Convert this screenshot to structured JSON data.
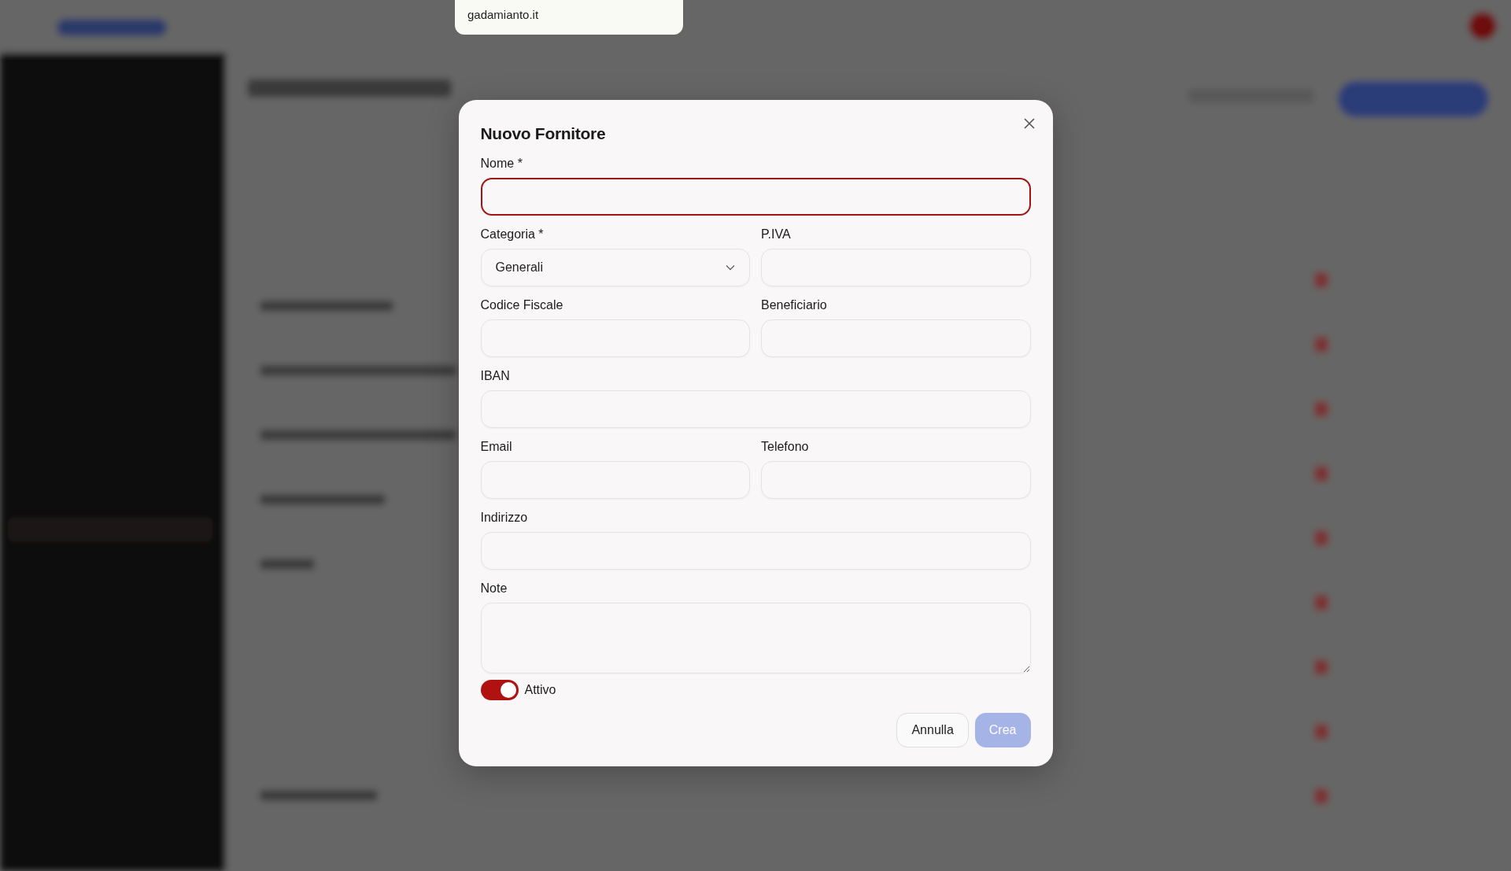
{
  "popup": {
    "text": "gadamianto.it"
  },
  "modal": {
    "title": "Nuovo Fornitore",
    "rows": [
      [
        {
          "label": "Nome *",
          "kind": "text",
          "focused": true
        }
      ],
      [
        {
          "label": "Categoria *",
          "kind": "select",
          "value": "Generali",
          "focused": false
        },
        {
          "label": "P.IVA",
          "kind": "text",
          "focused": false
        }
      ],
      [
        {
          "label": "Codice Fiscale",
          "kind": "text",
          "focused": false
        },
        {
          "label": "Beneficiario",
          "kind": "text",
          "focused": false
        }
      ],
      [
        {
          "label": "IBAN",
          "kind": "text",
          "focused": false
        }
      ],
      [
        {
          "label": "Email",
          "kind": "text",
          "focused": false
        },
        {
          "label": "Telefono",
          "kind": "text",
          "focused": false
        }
      ],
      [
        {
          "label": "Indirizzo",
          "kind": "text",
          "focused": false
        }
      ],
      [
        {
          "label": "Note",
          "kind": "textarea",
          "focused": false
        }
      ]
    ],
    "toggle": {
      "label": "Attivo",
      "on": true
    },
    "buttons": [
      {
        "label": "Annulla",
        "kind": "secondary",
        "disabled": false
      },
      {
        "label": "Crea",
        "kind": "primary",
        "disabled": true
      }
    ]
  }
}
